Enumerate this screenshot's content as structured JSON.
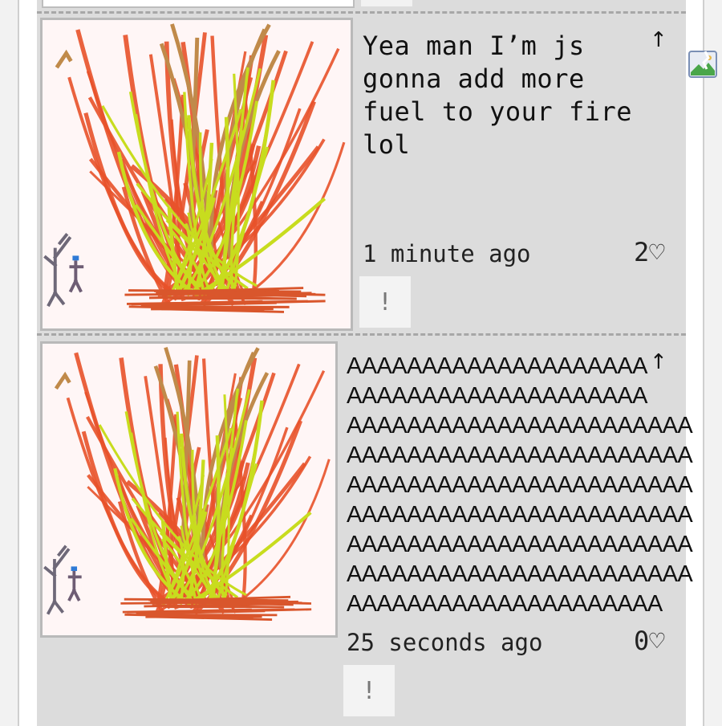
{
  "feed": {
    "posts": [
      {
        "text": "Yea man I’m js\ngonna add more\nfuel to your fire\nlol",
        "upvote_icon": "↑",
        "timestamp": "1 minute ago",
        "likes": "2♡",
        "report_label": "!",
        "drawing_icon": "fire-drawing"
      },
      {
        "text": "AAAAAAAAAAAAAAAAAAAA\nAAAAAAAAAAAAAAAAAAAA\nAAAAAAAAAAAAAAAAAAAAAAA\nAAAAAAAAAAAAAAAAAAAAAAA\nAAAAAAAAAAAAAAAAAAAAAAA\nAAAAAAAAAAAAAAAAAAAAAAA\nAAAAAAAAAAAAAAAAAAAAAAA\nAAAAAAAAAAAAAAAAAAAAAAA\nAAAAAAAAAAAAAAAAAAAAA",
        "upvote_icon": "↑",
        "timestamp": "25 seconds ago",
        "likes": "0♡",
        "report_label": "!",
        "drawing_icon": "fire-drawing"
      }
    ]
  },
  "colors": {
    "feed_background": "#dcdcdc",
    "drawing_background": "#fff6f6",
    "flame_orange": "#e8522a",
    "flame_yellow": "#c8dc1e",
    "flame_tan": "#c08a4a"
  },
  "icons": {
    "broken_image": "broken-image-icon"
  }
}
